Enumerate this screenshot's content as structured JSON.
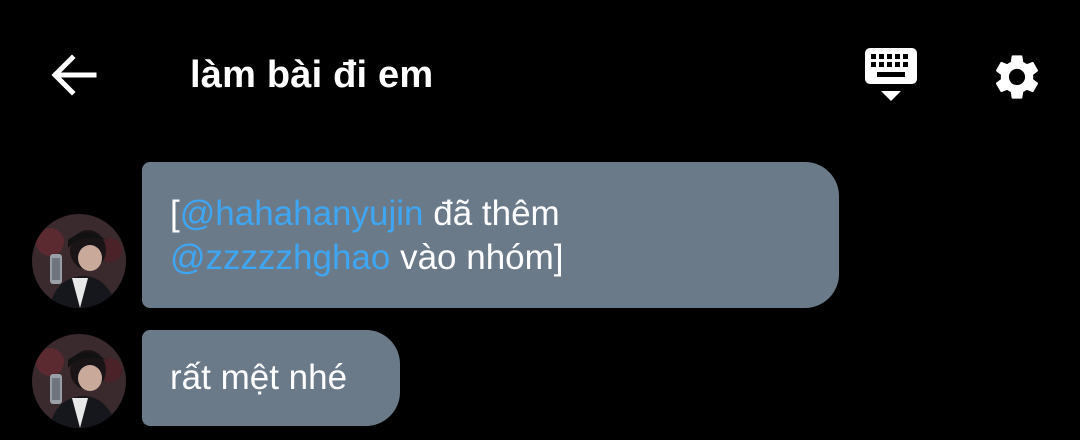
{
  "header": {
    "title": "làm bài đi em",
    "back_icon": "arrow-left-icon",
    "keyboard_icon": "keyboard-icon",
    "settings_icon": "gear-icon"
  },
  "messages": [
    {
      "avatar": "avatar",
      "parts": {
        "open_bracket": "[",
        "mention1": "@hahahanyujin",
        "text1": " đã thêm",
        "mention2": "@zzzzzhghao",
        "text2": " vào nhóm]"
      }
    },
    {
      "avatar": "avatar",
      "text": "rất mệt nhé"
    }
  ],
  "colors": {
    "background": "#000000",
    "bubble": "#6b7a89",
    "mention": "#3ea6f2",
    "text": "#ffffff"
  }
}
